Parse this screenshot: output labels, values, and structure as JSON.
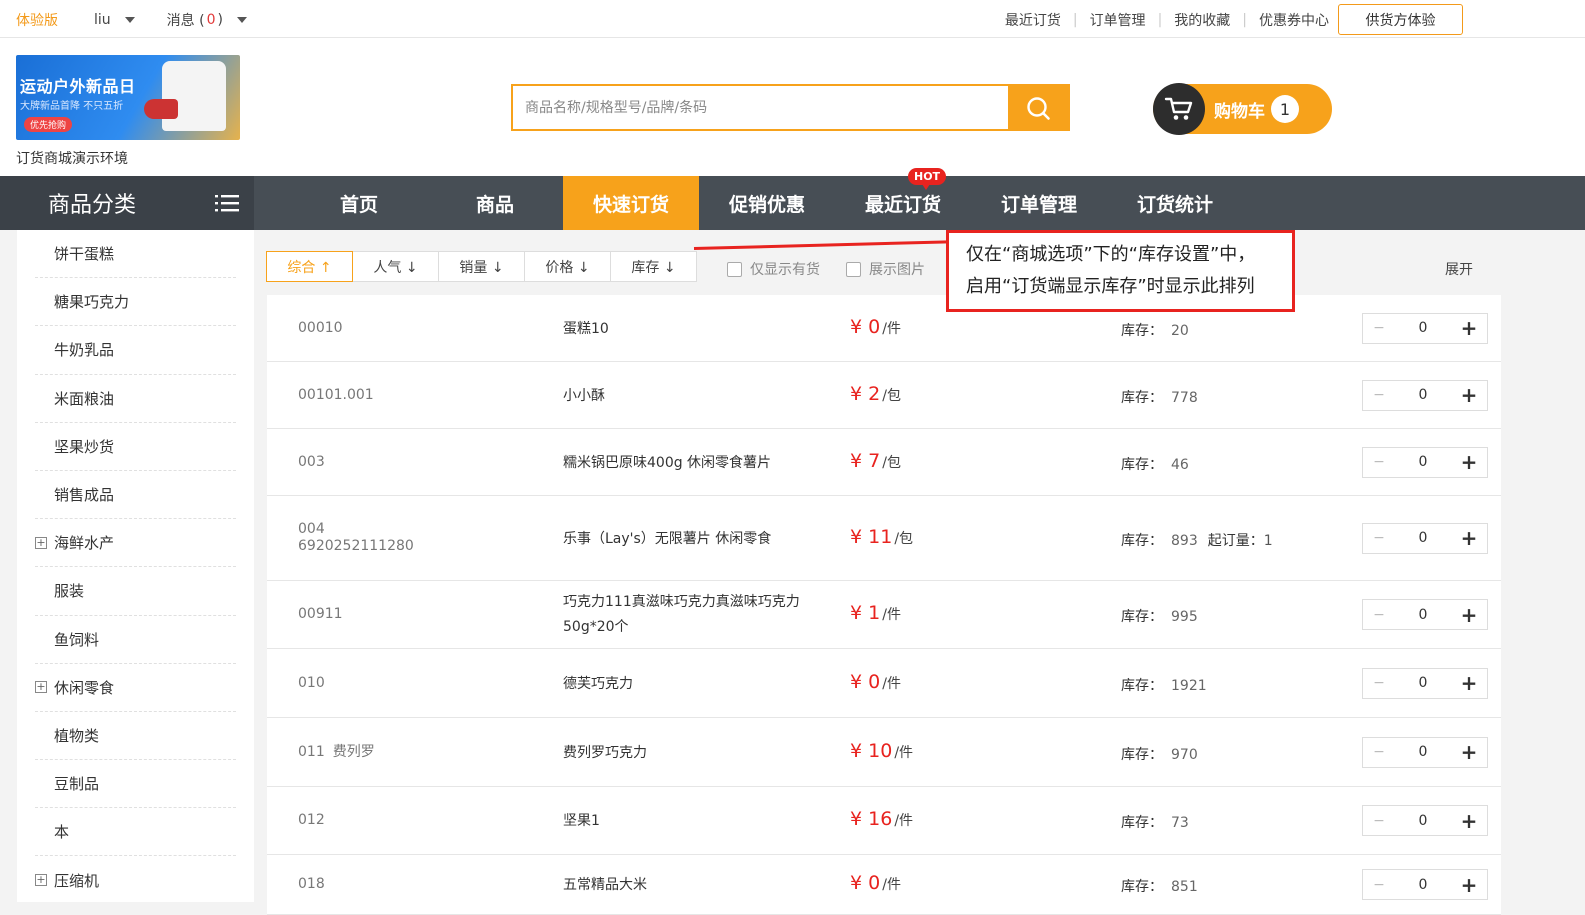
{
  "topbar": {
    "trial": "体验版",
    "user": "liu",
    "msg_label": "消息 (",
    "msg_count": "0",
    "msg_close": ")",
    "links": [
      "最近订货",
      "订单管理",
      "我的收藏",
      "优惠券中心"
    ],
    "supplier_button": "供货方体验"
  },
  "header": {
    "banner_title": "运动户外新品日",
    "banner_sub": "大牌新品首降 不只五折",
    "banner_cta": "优先抢购",
    "shop_name": "订货商城演示环境",
    "search_placeholder": "商品名称/规格型号/品牌/条码",
    "cart_label": "购物车",
    "cart_count": "1"
  },
  "nav": {
    "category_title": "商品分类",
    "items": [
      "首页",
      "商品",
      "快速订货",
      "促销优惠",
      "最近订货",
      "订单管理",
      "订货统计"
    ],
    "active_index": 2,
    "hot_badge": "HOT"
  },
  "sidebar": {
    "items": [
      {
        "label": "饼干蛋糕",
        "expandable": false
      },
      {
        "label": "糖果巧克力",
        "expandable": false
      },
      {
        "label": "牛奶乳品",
        "expandable": false
      },
      {
        "label": "米面粮油",
        "expandable": false
      },
      {
        "label": "坚果炒货",
        "expandable": false
      },
      {
        "label": "销售成品",
        "expandable": false
      },
      {
        "label": "海鲜水产",
        "expandable": true
      },
      {
        "label": "服装",
        "expandable": false
      },
      {
        "label": "鱼饲料",
        "expandable": false
      },
      {
        "label": "休闲零食",
        "expandable": true
      },
      {
        "label": "植物类",
        "expandable": false
      },
      {
        "label": "豆制品",
        "expandable": false
      },
      {
        "label": "本",
        "expandable": false
      },
      {
        "label": "压缩机",
        "expandable": true
      }
    ]
  },
  "sortbar": {
    "options": [
      "综合 ↑",
      "人气 ↓",
      "销量 ↓",
      "价格 ↓",
      "库存 ↓"
    ],
    "active_index": 0,
    "filter_in_stock": "仅显示有货",
    "filter_images": "展示图片",
    "expand": "展开"
  },
  "annotation": {
    "line1": "仅在“商城选项”下的“库存设置”中，",
    "line2": "启用“订货端显示库存”时显示此排列"
  },
  "products": {
    "stock_label": "库存：",
    "moq_label": "起订量：",
    "currency": "¥",
    "rows": [
      {
        "code": "00010",
        "code2": "",
        "alias": "",
        "name": "蛋糕10",
        "price": "0",
        "unit": "/件",
        "stock": "20",
        "moq": "",
        "qty": "0"
      },
      {
        "code": "00101.001",
        "code2": "",
        "alias": "",
        "name": "小小酥",
        "price": "2",
        "unit": "/包",
        "stock": "778",
        "moq": "",
        "qty": "0"
      },
      {
        "code": "003",
        "code2": "",
        "alias": "",
        "name": "糯米锅巴原味400g 休闲零食薯片",
        "price": "7",
        "unit": "/包",
        "stock": "46",
        "moq": "",
        "qty": "0"
      },
      {
        "code": "004",
        "code2": "6920252111280",
        "alias": "",
        "name": "乐事（Lay's）无限薯片 休闲零食",
        "price": "11",
        "unit": "/包",
        "stock": "893",
        "moq": "1",
        "qty": "0"
      },
      {
        "code": "00911",
        "code2": "",
        "alias": "",
        "name": "巧克力111真滋味巧克力真滋味巧克力50g*20个",
        "price": "1",
        "unit": "/件",
        "stock": "995",
        "moq": "",
        "qty": "0"
      },
      {
        "code": "010",
        "code2": "",
        "alias": "",
        "name": "德芙巧克力",
        "price": "0",
        "unit": "/件",
        "stock": "1921",
        "moq": "",
        "qty": "0"
      },
      {
        "code": "011",
        "code2": "",
        "alias": "费列罗",
        "name": "费列罗巧克力",
        "price": "10",
        "unit": "/件",
        "stock": "970",
        "moq": "",
        "qty": "0"
      },
      {
        "code": "012",
        "code2": "",
        "alias": "",
        "name": "坚果1",
        "price": "16",
        "unit": "/件",
        "stock": "73",
        "moq": "",
        "qty": "0"
      },
      {
        "code": "018",
        "code2": "",
        "alias": "",
        "name": "五常精品大米",
        "price": "0",
        "unit": "/件",
        "stock": "851",
        "moq": "",
        "qty": "0"
      }
    ]
  },
  "colors": {
    "accent": "#f7a21b",
    "price": "#e8231f",
    "nav": "#474e55"
  }
}
